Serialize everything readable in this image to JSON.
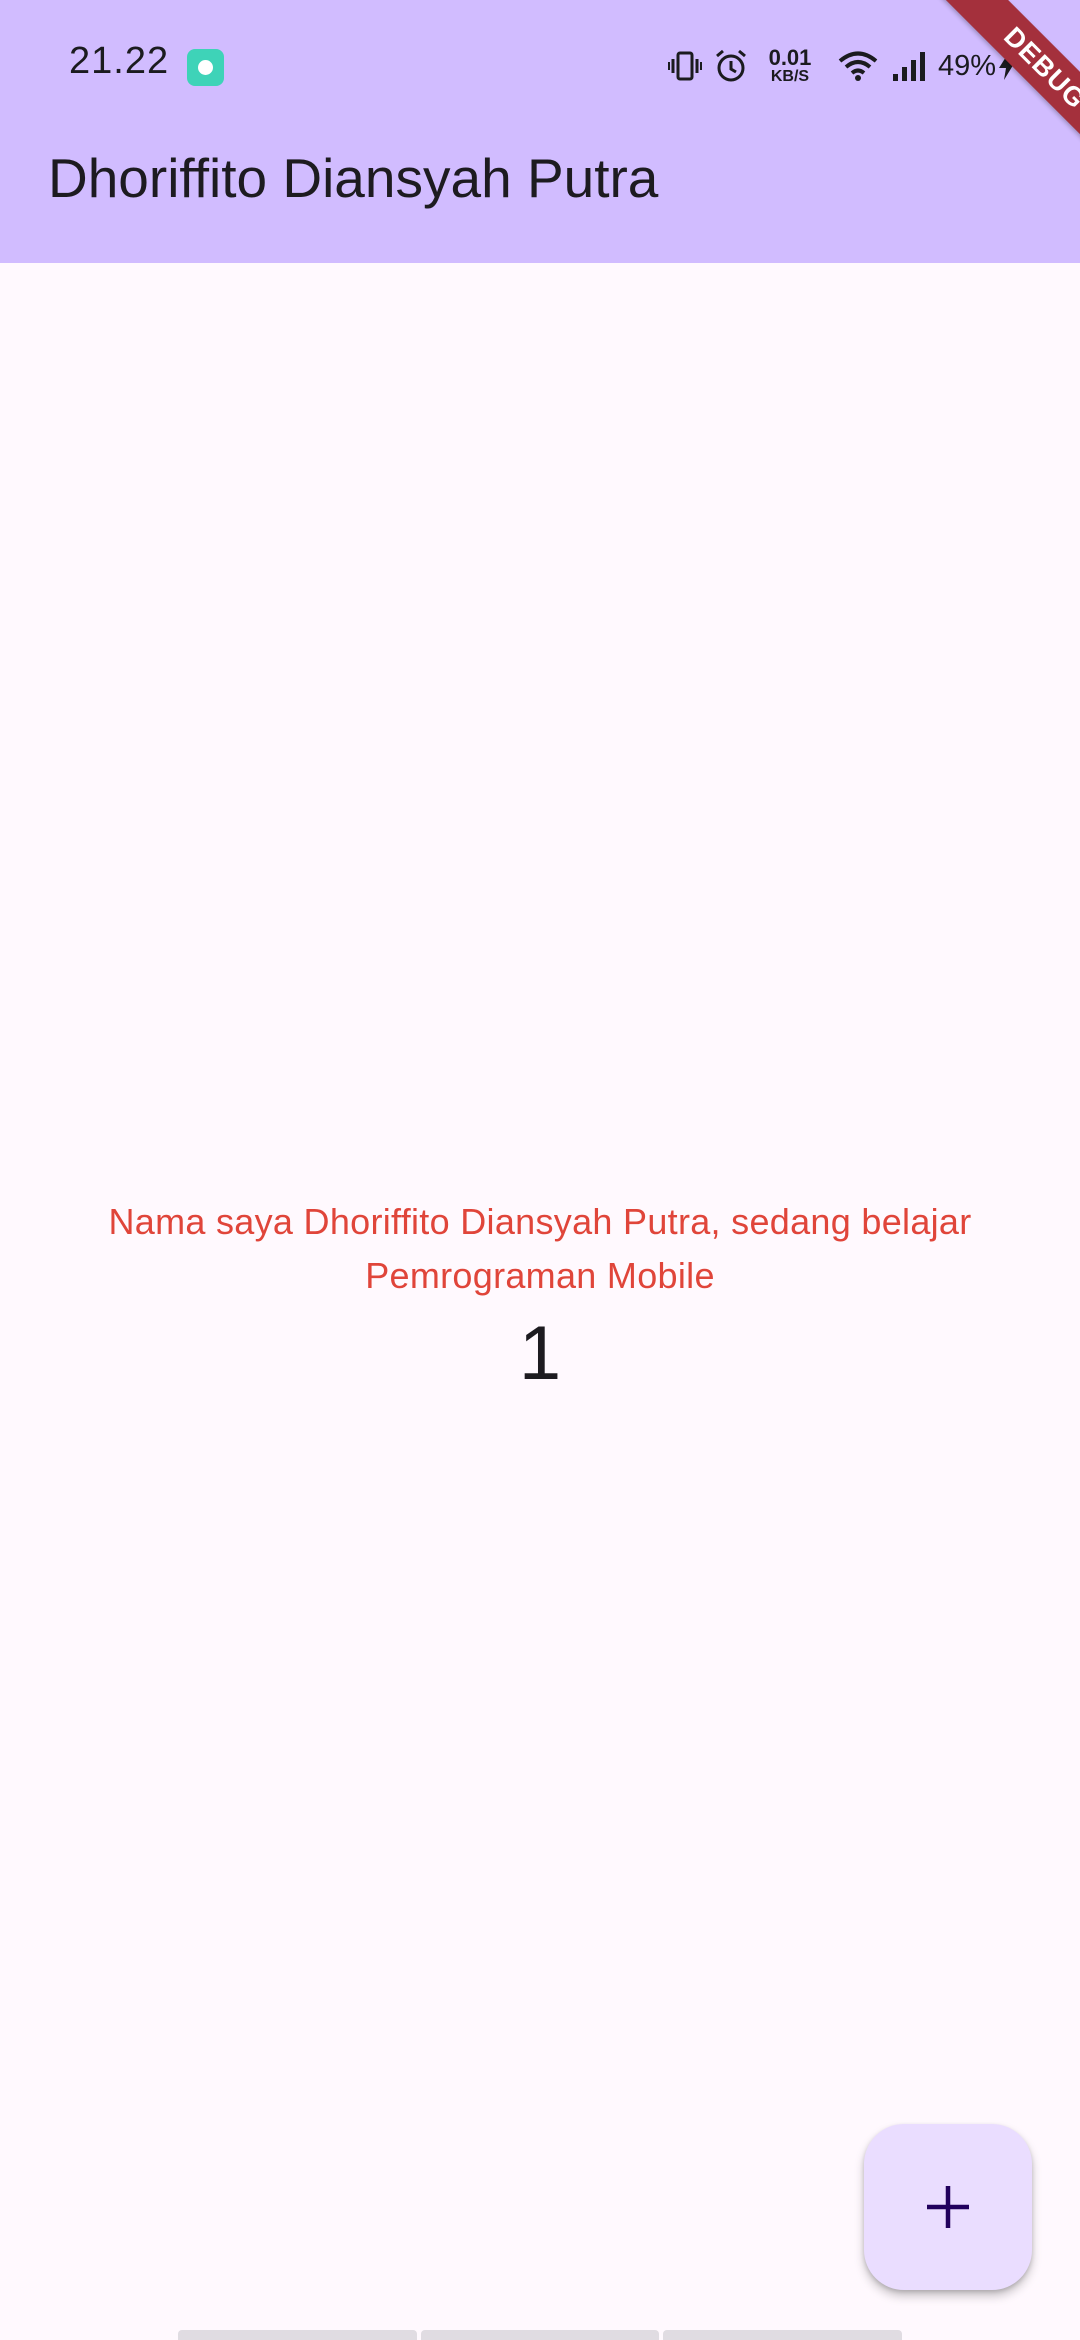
{
  "status_bar": {
    "time": "21.22",
    "net_speed_value": "0.01",
    "net_speed_unit": "KB/S",
    "battery": "49%",
    "icons": [
      "vibrate-icon",
      "alarm-icon",
      "wifi-icon",
      "signal-icon",
      "charging-icon"
    ]
  },
  "app_bar": {
    "title": "Dhoriffito Diansyah Putra"
  },
  "debug_banner": {
    "label": "DEBUG"
  },
  "main": {
    "message": "Nama saya Dhoriffito Diansyah Putra, sedang belajar Pemrograman Mobile",
    "counter": "1"
  },
  "fab": {
    "icon": "plus-icon"
  },
  "colors": {
    "app_bar": "#D1BCFF",
    "background": "#FFF9FE",
    "message_text": "#E0453A",
    "fab_background": "#EADDFF",
    "debug_banner": "#A4303C"
  }
}
